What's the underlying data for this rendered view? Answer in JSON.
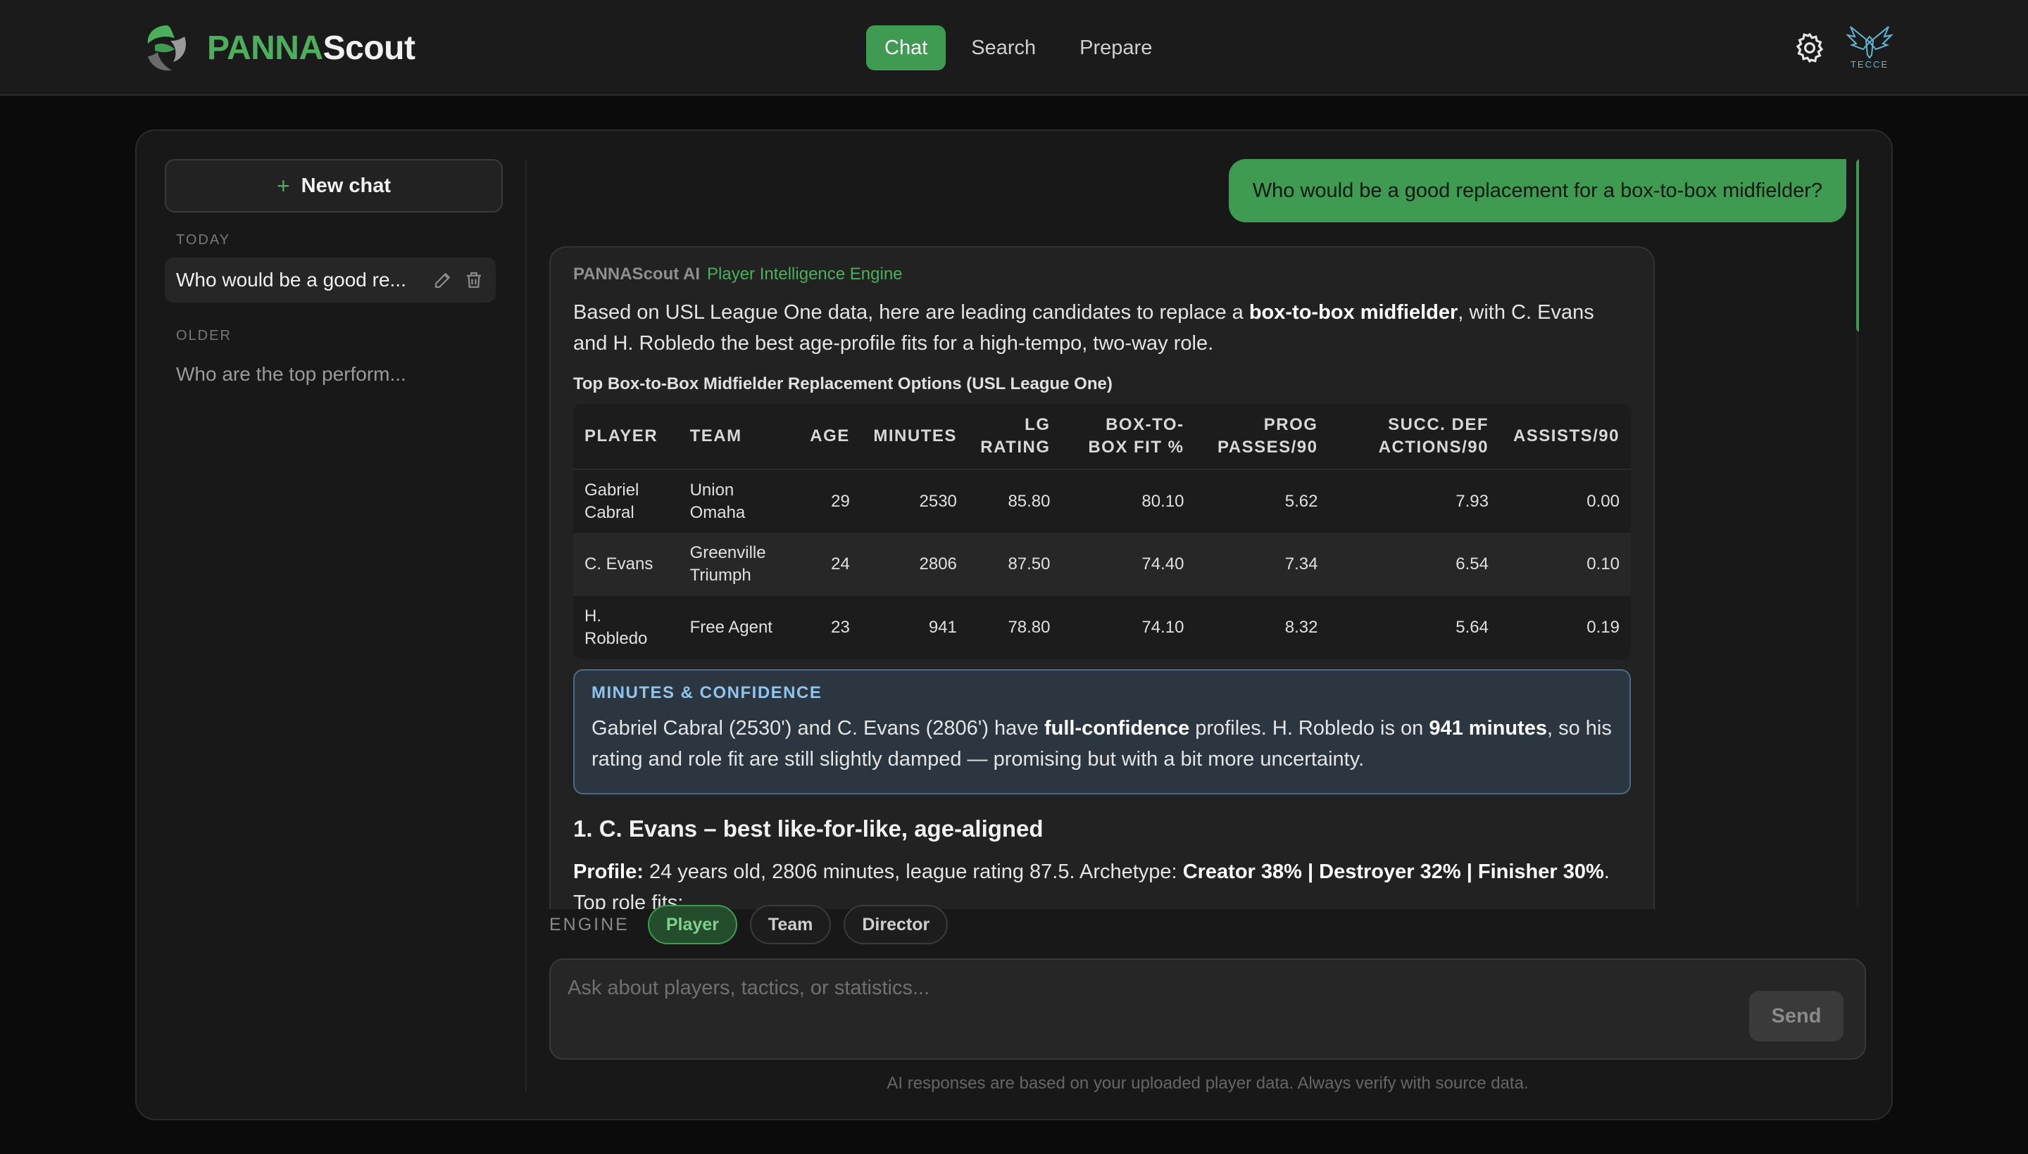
{
  "app": {
    "logo_part1": "PANNA",
    "logo_part2": "Scout",
    "accent_color": "#3f9a52",
    "nav": [
      {
        "label": "Chat",
        "active": true
      },
      {
        "label": "Search",
        "active": false
      },
      {
        "label": "Prepare",
        "active": false
      }
    ],
    "icons": {
      "settings": "gear-icon",
      "team_badge": "eagle-badge-icon"
    },
    "badge_text": "TECCE"
  },
  "sidebar": {
    "new_chat_label": "New chat",
    "today_label": "TODAY",
    "older_label": "OLDER",
    "today_items": [
      {
        "title": "Who would be a good re..."
      }
    ],
    "older_items": [
      {
        "title": "Who are the top perform..."
      }
    ]
  },
  "chat": {
    "user_message": "Who would be a good replacement for a box-to-box midfielder?",
    "ai": {
      "sender": "PANNAScout AI",
      "engine_name": "Player Intelligence Engine",
      "intro_pre": "Based on USL League One data, here are leading candidates to replace a ",
      "intro_bold": "box-to-box midfielder",
      "intro_post": ", with C. Evans and H. Robledo the best age-profile fits for a high-tempo, two-way role.",
      "table_title": "Top Box-to-Box Midfielder Replacement Options (USL League One)",
      "table": {
        "headers": [
          "PLAYER",
          "TEAM",
          "AGE",
          "MINUTES",
          "LG RATING",
          "BOX-TO-BOX FIT %",
          "PROG PASSES/90",
          "SUCC. DEF ACTIONS/90",
          "ASSISTS/90"
        ],
        "rows": [
          [
            "Gabriel Cabral",
            "Union Omaha",
            "29",
            "2530",
            "85.80",
            "80.10",
            "5.62",
            "7.93",
            "0.00"
          ],
          [
            "C. Evans",
            "Greenville Triumph",
            "24",
            "2806",
            "87.50",
            "74.40",
            "7.34",
            "6.54",
            "0.10"
          ],
          [
            "H. Robledo",
            "Free Agent",
            "23",
            "941",
            "78.80",
            "74.10",
            "8.32",
            "5.64",
            "0.19"
          ]
        ]
      },
      "callout": {
        "title": "MINUTES & CONFIDENCE",
        "p1": "Gabriel Cabral (2530') and C. Evans (2806') have ",
        "b1": "full-confidence",
        "p2": " profiles. H. Robledo is on ",
        "b2": "941 minutes",
        "p3": ", so his rating and role fit are still slightly damped — promising but with a bit more uncertainty."
      },
      "section1_heading": "1. C. Evans – best like-for-like, age-aligned",
      "profile_label": "Profile:",
      "profile_text": " 24 years old, 2806 minutes, league rating 87.5. Archetype: ",
      "profile_bold": "Creator 38% | Destroyer 32% | Finisher 30%",
      "profile_end": ".",
      "top_role_fits": "Top role fits:"
    }
  },
  "composer": {
    "engine_label": "ENGINE",
    "engines": [
      {
        "label": "Player",
        "active": true
      },
      {
        "label": "Team",
        "active": false
      },
      {
        "label": "Director",
        "active": false
      }
    ],
    "placeholder": "Ask about players, tactics, or statistics...",
    "send_label": "Send",
    "footnote": "AI responses are based on your uploaded player data. Always verify with source data."
  }
}
